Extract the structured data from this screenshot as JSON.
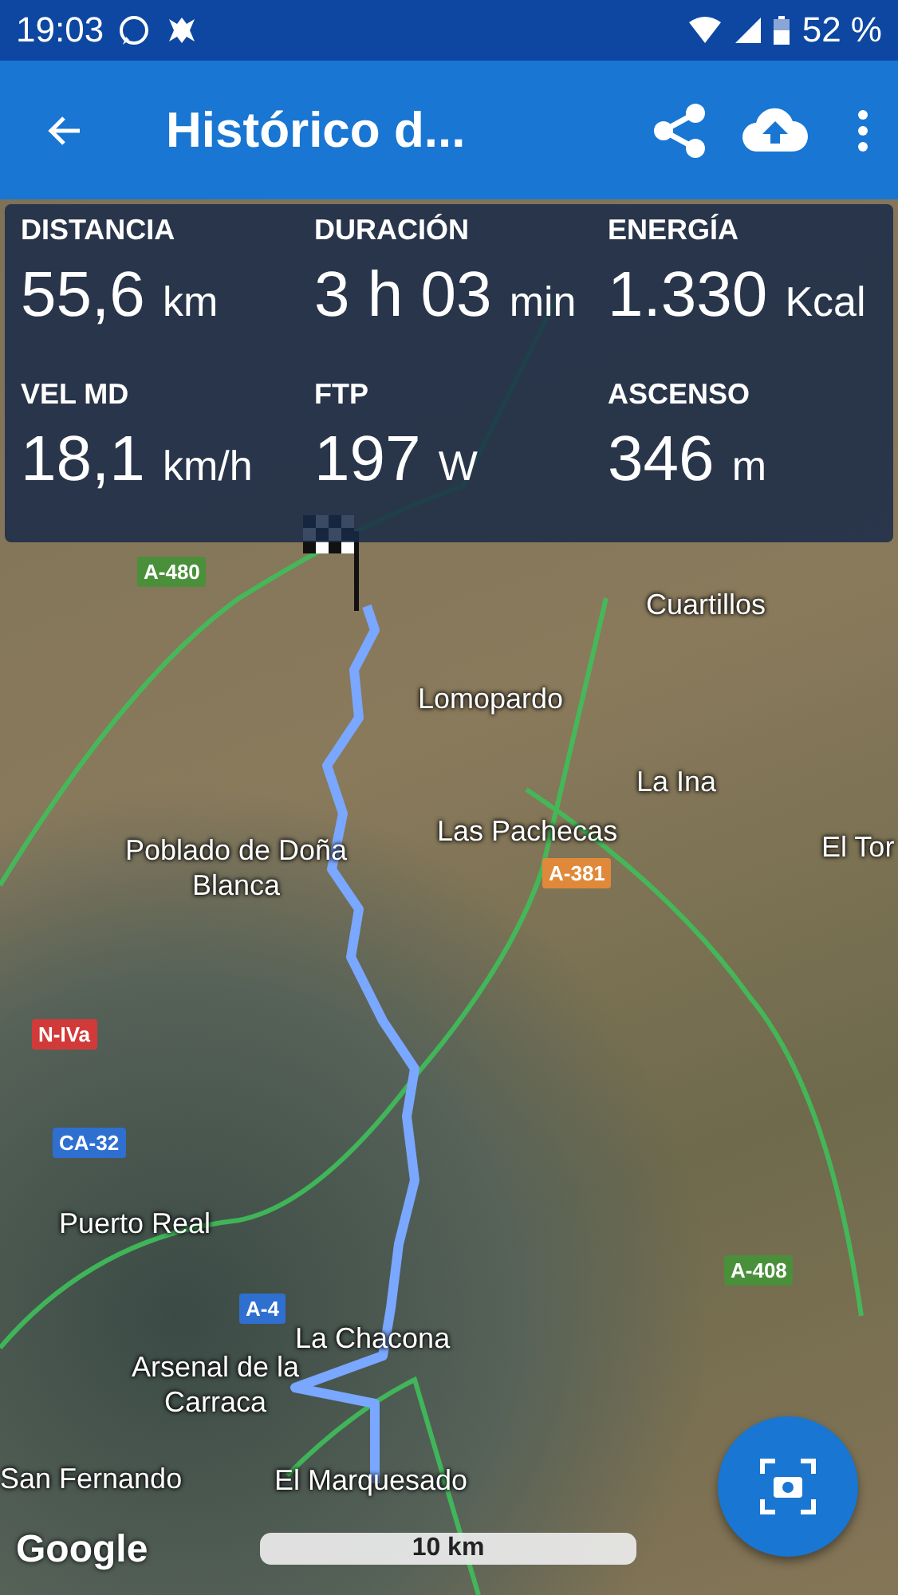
{
  "status_bar": {
    "time": "19:03",
    "battery": "52 %"
  },
  "app_bar": {
    "title": "Histórico d..."
  },
  "stats": [
    {
      "label": "DISTANCIA",
      "value": "55,6",
      "unit": "km"
    },
    {
      "label": "DURACIÓN",
      "value": "3 h 03",
      "unit": "min"
    },
    {
      "label": "ENERGÍA",
      "value": "1.330",
      "unit": "Kcal"
    },
    {
      "label": "VEL MD",
      "value": "18,1",
      "unit": "km/h"
    },
    {
      "label": "FTP",
      "value": "197",
      "unit": "W"
    },
    {
      "label": "ASCENSO",
      "value": "346",
      "unit": "m"
    }
  ],
  "map": {
    "places": [
      "Cuartillos",
      "Lomopardo",
      "La Ina",
      "Las Pachecas",
      "El Tor",
      "Poblado de Doña Blanca",
      "Puerto Real",
      "La Chacona",
      "Arsenal de la Carraca",
      "San Fernando",
      "El Marquesado"
    ],
    "roads": [
      {
        "label": "A-480",
        "color": "#4a8f3a"
      },
      {
        "label": "A-381",
        "color": "#e0893a"
      },
      {
        "label": "N-IVa",
        "color": "#d23a3a"
      },
      {
        "label": "CA-32",
        "color": "#2f6fd0"
      },
      {
        "label": "A-4",
        "color": "#2f6fd0"
      },
      {
        "label": "A-408",
        "color": "#4a8f3a"
      }
    ],
    "attribution": "Google",
    "scale": "10 km"
  }
}
